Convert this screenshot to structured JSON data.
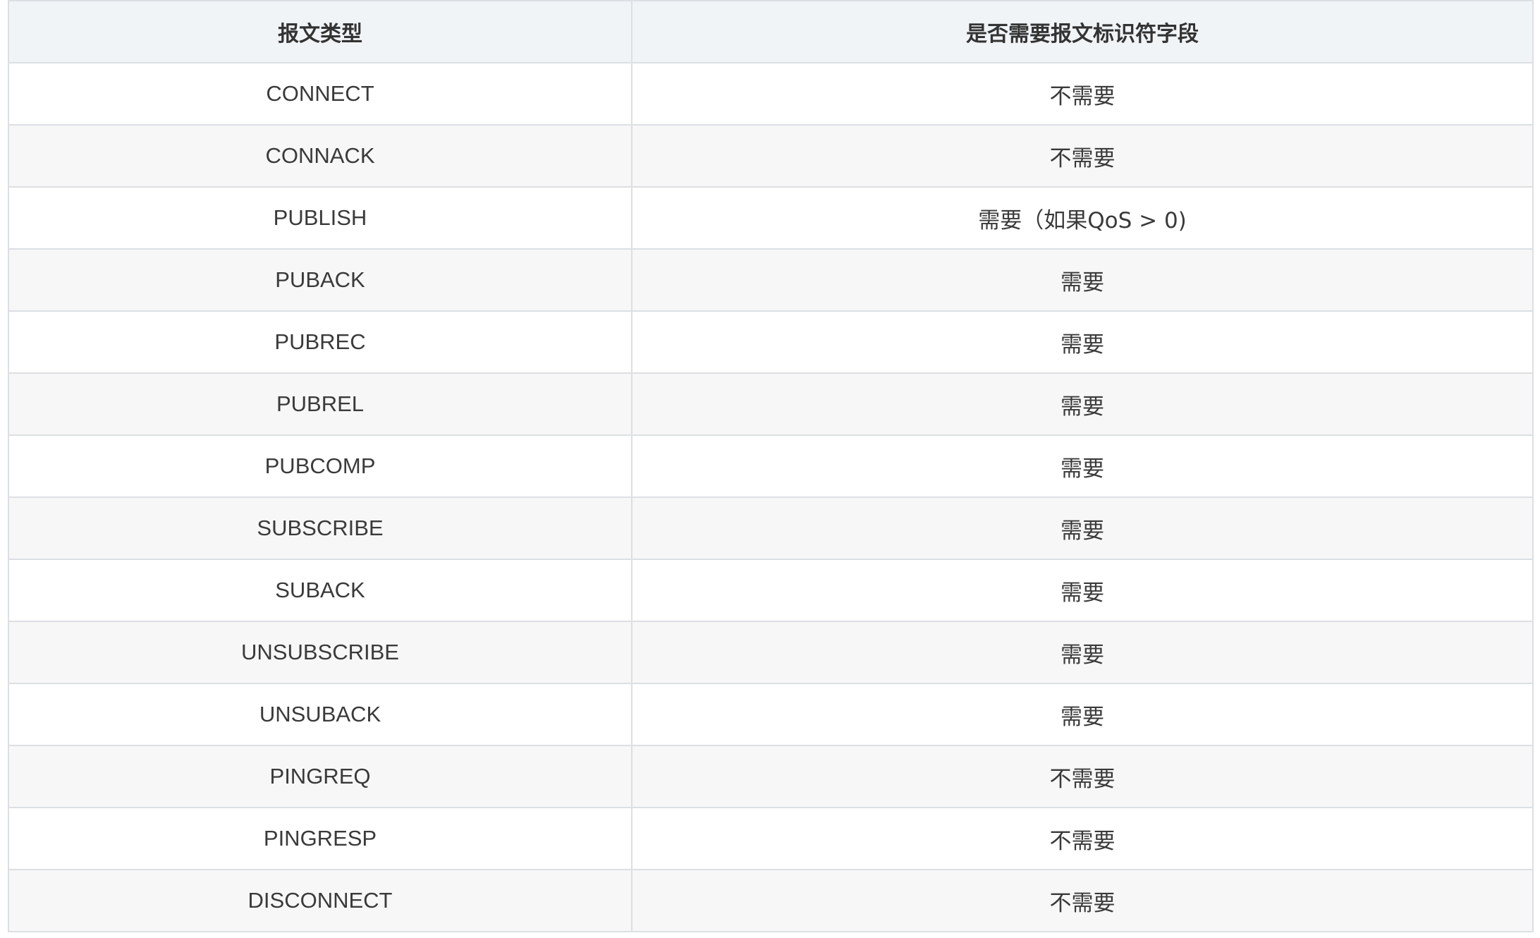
{
  "table": {
    "headers": {
      "type": "报文类型",
      "needs_id": "是否需要报文标识符字段"
    },
    "rows": [
      {
        "type": "CONNECT",
        "needs_id": "不需要"
      },
      {
        "type": "CONNACK",
        "needs_id": "不需要"
      },
      {
        "type": "PUBLISH",
        "needs_id": "需要（如果QoS > 0)"
      },
      {
        "type": "PUBACK",
        "needs_id": "需要"
      },
      {
        "type": "PUBREC",
        "needs_id": "需要"
      },
      {
        "type": "PUBREL",
        "needs_id": "需要"
      },
      {
        "type": "PUBCOMP",
        "needs_id": "需要"
      },
      {
        "type": "SUBSCRIBE",
        "needs_id": "需要"
      },
      {
        "type": "SUBACK",
        "needs_id": "需要"
      },
      {
        "type": "UNSUBSCRIBE",
        "needs_id": "需要"
      },
      {
        "type": "UNSUBACK",
        "needs_id": "需要"
      },
      {
        "type": "PINGREQ",
        "needs_id": "不需要"
      },
      {
        "type": "PINGRESP",
        "needs_id": "不需要"
      },
      {
        "type": "DISCONNECT",
        "needs_id": "不需要"
      }
    ]
  },
  "colors": {
    "header_bg": "#f1f4f7",
    "row_alt_bg": "#f7f7f7",
    "border": "#dcdfe3",
    "text": "#333333"
  }
}
